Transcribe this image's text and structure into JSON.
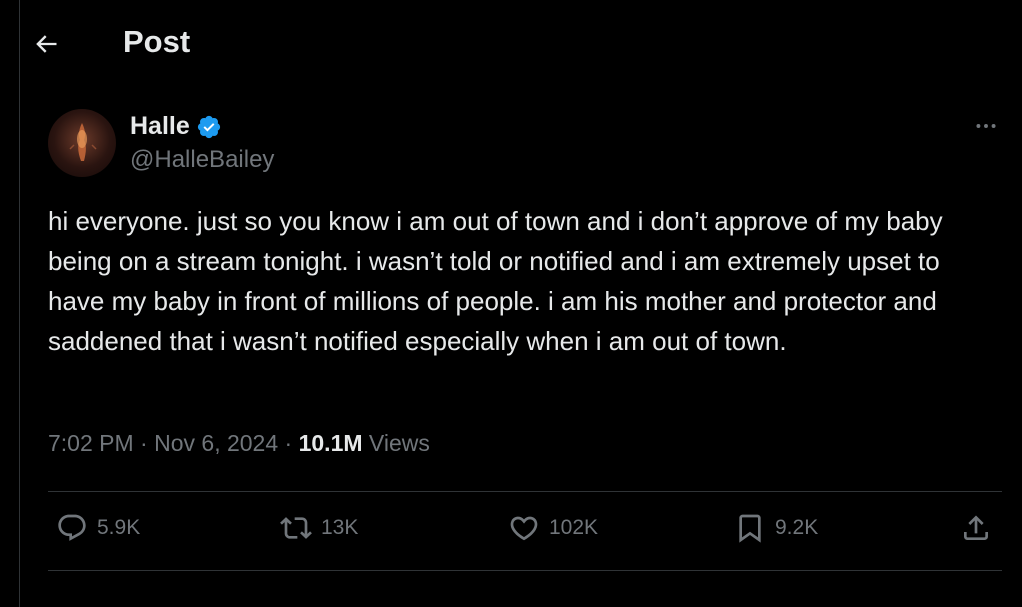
{
  "header": {
    "title": "Post"
  },
  "author": {
    "name": "Halle",
    "handle": "@HalleBailey",
    "verified": true
  },
  "tweet": {
    "text": "hi everyone. just so you know i am out of town and i don’t approve of my baby being on a stream tonight. i wasn’t told or notified and i am extremely upset to have my baby in front of millions of people. i am his mother and protector and saddened that i wasn’t notified especially when i am out of town."
  },
  "meta": {
    "time": "7:02 PM",
    "date": "Nov 6, 2024",
    "views_count": "10.1M",
    "views_label": "Views"
  },
  "actions": {
    "replies": "5.9K",
    "reposts": "13K",
    "likes": "102K",
    "bookmarks": "9.2K"
  },
  "colors": {
    "background": "#000000",
    "text": "#e7e9ea",
    "muted": "#71767b",
    "verified": "#1d9bf0",
    "divider": "#2f3336"
  },
  "icons": [
    "back-arrow-icon",
    "verified-badge-icon",
    "more-icon",
    "reply-icon",
    "repost-icon",
    "like-icon",
    "bookmark-icon",
    "share-icon"
  ]
}
